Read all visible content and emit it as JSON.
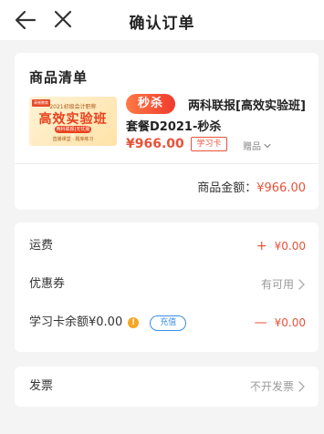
{
  "header": {
    "title": "确认订单",
    "back_icon": "back-arrow-icon",
    "close_icon": "close-icon"
  },
  "products": {
    "section_title": "商品清单",
    "item": {
      "thumbnail": {
        "badge": "高顿教育",
        "line1": "2021初级会计职称",
        "main": "高效实验班",
        "tag": "两科联报|无忧服务",
        "foot": "直播课堂 · 题库练习"
      },
      "flash_label": "秒杀",
      "name_line1": "两科联报[高效实验班]",
      "name_line2": "套餐D2021-秒杀",
      "price": "¥966.00",
      "card_tag": "学习卡",
      "gift_label": "赠品"
    },
    "subtotal_label": "商品金额：",
    "subtotal_value": "¥966.00"
  },
  "fees": {
    "shipping": {
      "label": "运费",
      "sign": "+",
      "value": "¥0.00"
    },
    "coupon": {
      "label": "优惠券",
      "value": "有可用"
    },
    "study_card": {
      "label": "学习卡余额¥0.00",
      "info": "!",
      "topup_label": "充值",
      "sign": "—",
      "value": "¥0.00"
    }
  },
  "invoice": {
    "label": "发票",
    "value": "不开发票"
  },
  "colors": {
    "accent_red": "#e8523a",
    "blue": "#3a8ee6",
    "info_orange": "#f5a623"
  }
}
